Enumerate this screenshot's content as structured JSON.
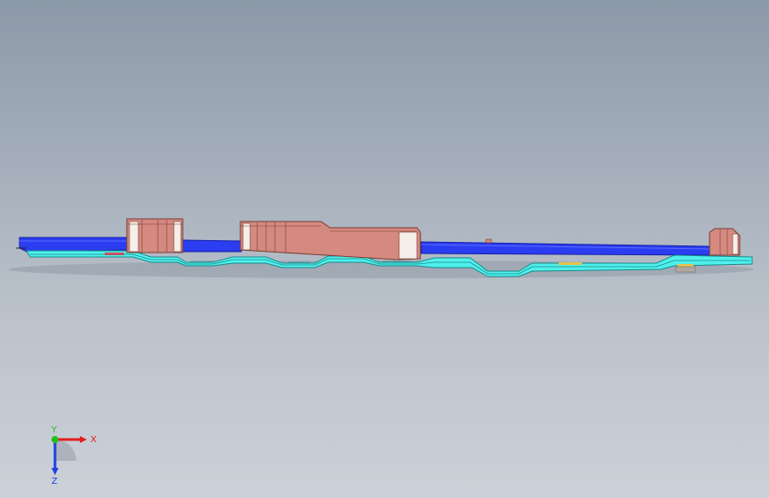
{
  "viewport": {
    "background_top": "#8c99a8",
    "background_bottom": "#ccd1d8"
  },
  "model": {
    "colors": {
      "plate": "#2b3df0",
      "plate_edge": "#1520a8",
      "frame": "#4ff0ec",
      "frame_edge": "#1a8a8a",
      "block": "#d48a80",
      "block_edge": "#7a3b32",
      "highlight": "#f4efe8",
      "accent_yellow": "#e8c24a",
      "accent_red": "#c8505a"
    }
  },
  "triad": {
    "x_label": "X",
    "y_label": "Y",
    "z_label": "Z",
    "x_color": "#e02020",
    "y_color": "#20c020",
    "z_color": "#2040e0"
  }
}
